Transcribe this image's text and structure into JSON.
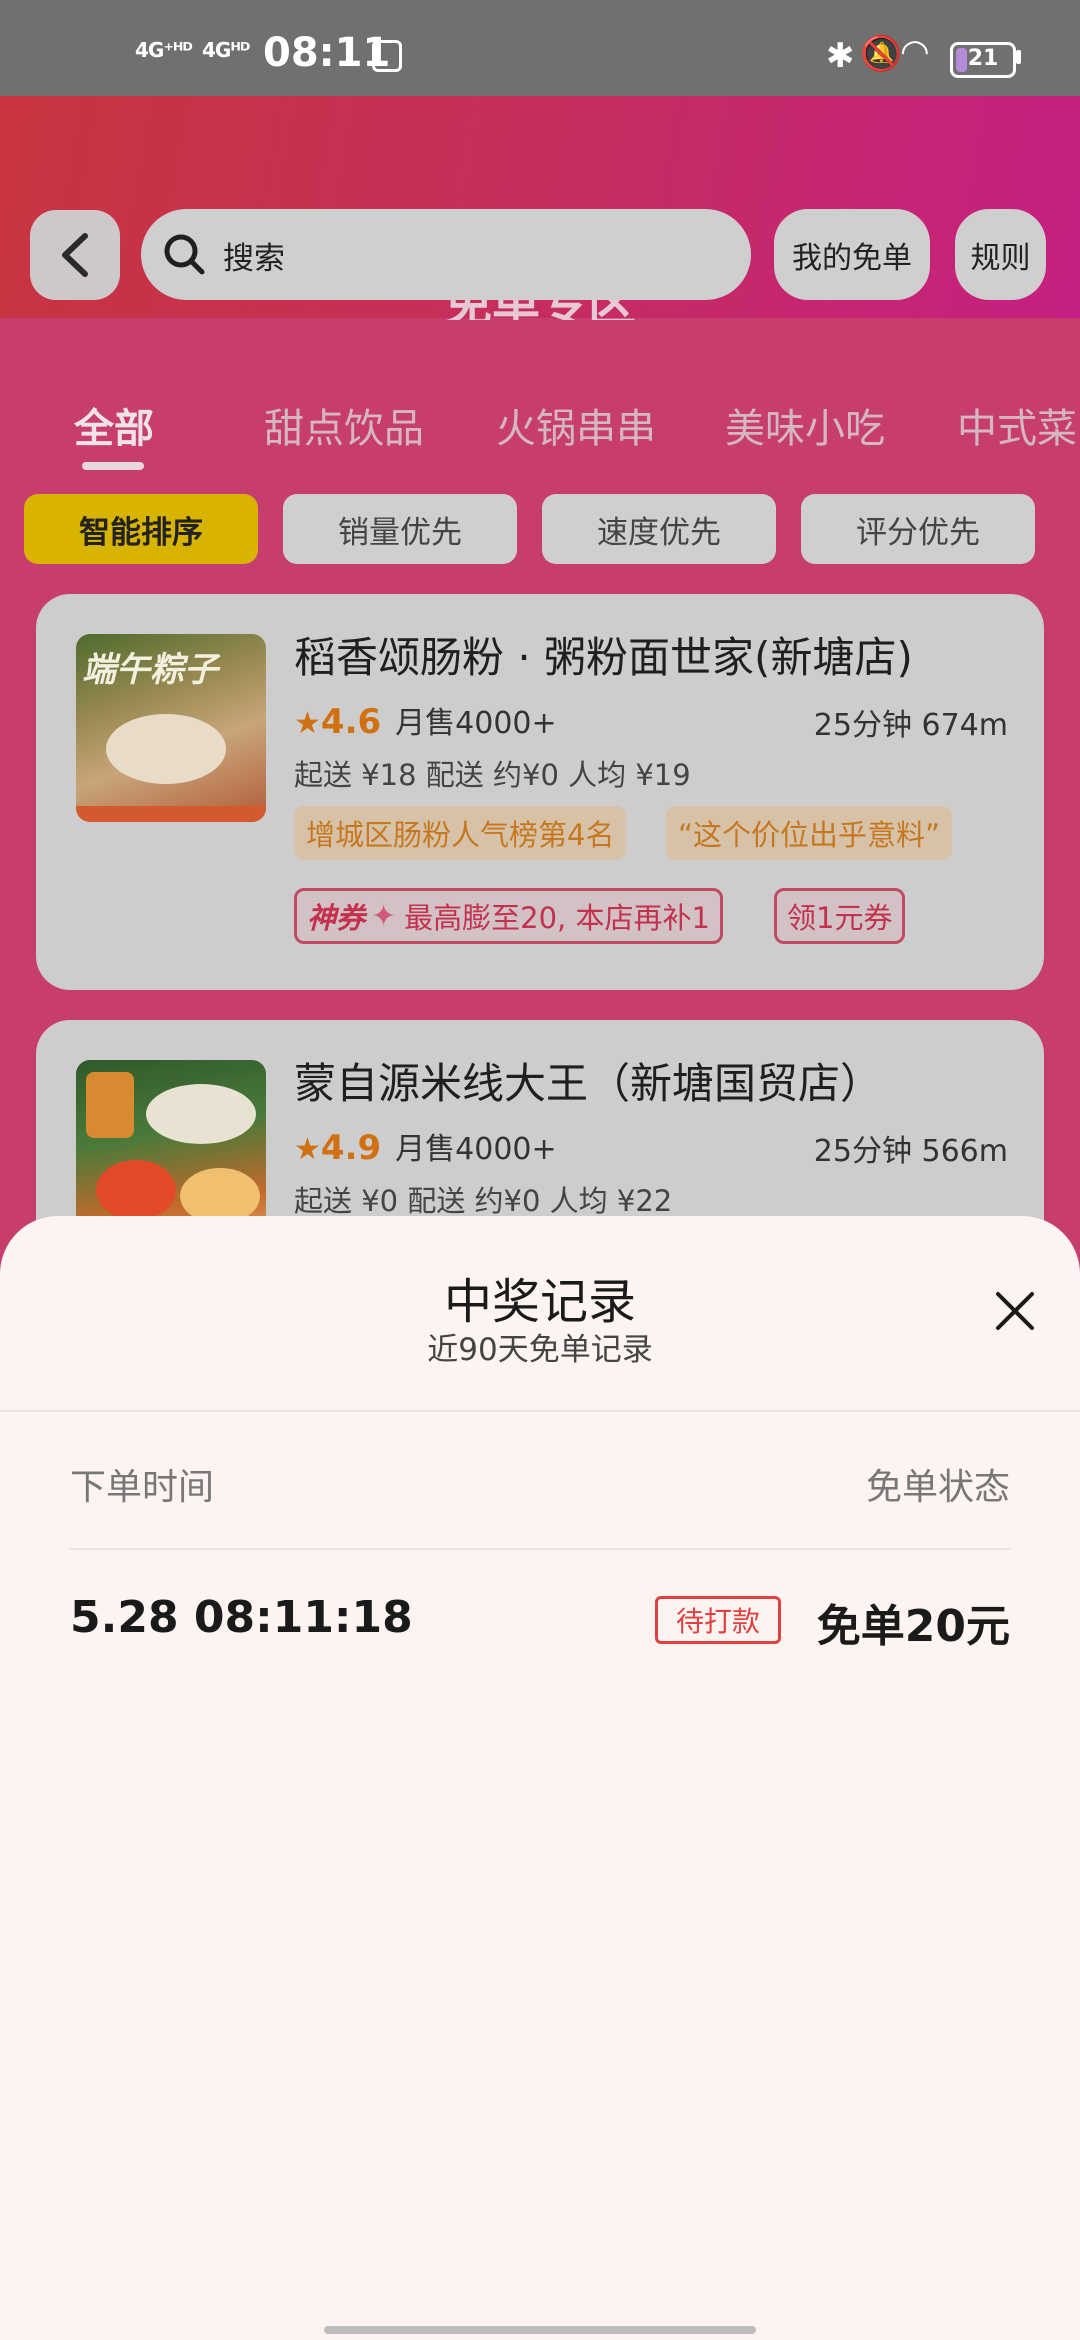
{
  "status_bar": {
    "sim1": "4G⁺ᴴᴰ",
    "sim2": "4Gᴴᴰ",
    "time": "08:11",
    "battery": "21",
    "battery_level": 0.21,
    "icons": [
      "bluetooth-icon",
      "mute-icon",
      "wifi-icon",
      "battery-icon"
    ]
  },
  "header": {
    "search_placeholder": "搜索",
    "my_free_button": "我的免单",
    "rules_button": "规则"
  },
  "zone_title": "免单专区",
  "tabs": [
    {
      "label": "全部",
      "active": true
    },
    {
      "label": "甜点饮品"
    },
    {
      "label": "火锅串串"
    },
    {
      "label": "美味小吃"
    },
    {
      "label": "中式菜"
    }
  ],
  "sort_options": [
    {
      "label": "智能排序",
      "active": true
    },
    {
      "label": "销量优先"
    },
    {
      "label": "速度优先"
    },
    {
      "label": "评分优先"
    }
  ],
  "stores": [
    {
      "name": "稻香颂肠粉 · 粥粉面世家(新塘店)",
      "rating": "4.6",
      "monthly_sales": "月售4000+",
      "eta": "25分钟 674m",
      "fees": "起送 ¥18 配送 约¥0 人均 ¥19",
      "tags": [
        "增城区肠粉人气榜第4名",
        "“这个价位出乎意料”"
      ],
      "coupon_badge": "神券",
      "coupon_text": "最高膨至20, 本店再补1",
      "coupon_claim": "领1元券",
      "thumb_text": "端午粽子"
    },
    {
      "name": "蒙自源米线大王（新塘国贸店）",
      "rating": "4.9",
      "monthly_sales": "月售4000+",
      "eta": "25分钟 566m",
      "fees": "起送 ¥0 配送 约¥0 人均 ¥22"
    }
  ],
  "sheet": {
    "title": "中奖记录",
    "subtitle": "近90天免单记录",
    "col_time": "下单时间",
    "col_status": "免单状态",
    "records": [
      {
        "time": "5.28 08:11:18",
        "status": "待打款",
        "amount": "免单20元"
      }
    ]
  },
  "colors": {
    "header_gradient_start": "#c9343f",
    "header_gradient_end": "#c61f83",
    "active_sort": "#d8b300",
    "rating": "#d07010",
    "badge_red": "#e04040"
  }
}
